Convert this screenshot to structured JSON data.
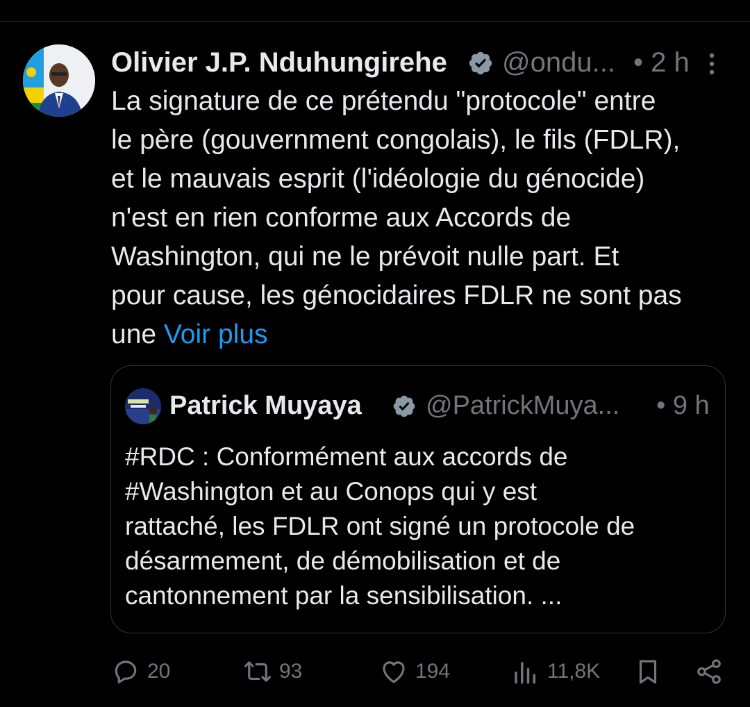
{
  "tweet": {
    "author_name": "Olivier J.P. Nduhungirehe",
    "handle": "@ondu...",
    "time": "• 2 h",
    "text_lines": [
      "La signature de ce prétendu \"protocole\" entre",
      "le père (gouvernment congolais), le fils (FDLR),",
      "et le mauvais esprit (l'idéologie du génocide)",
      "n'est en rien conforme aux Accords de",
      "Washington, qui ne le prévoit nulle part. Et",
      "pour cause, les génocidaires FDLR ne sont pas",
      "une"
    ],
    "see_more": "Voir plus",
    "avatar_icon": "profile-photo",
    "verified_icon": "verified-badge-icon",
    "more_icon": "more-vertical-icon"
  },
  "quote": {
    "author_name": "Patrick Muyaya",
    "handle": "@PatrickMuya...",
    "time": "• 9 h",
    "text_lines": [
      "#RDC : Conformément aux accords de",
      "#Washington et au Conops qui y est",
      "rattaché, les FDLR ont signé un protocole de",
      "désarmement, de démobilisation et de",
      "cantonnement par la sensibilisation. ..."
    ]
  },
  "actions": {
    "replies": "20",
    "reposts": "93",
    "likes": "194",
    "views": "11,8K",
    "reply_icon": "reply-icon",
    "repost_icon": "repost-icon",
    "like_icon": "heart-icon",
    "views_icon": "views-chart-icon",
    "bookmark_icon": "bookmark-icon",
    "share_icon": "share-icon"
  },
  "colors": {
    "background": "#000000",
    "text": "#e7e9ea",
    "muted": "#71767b",
    "link": "#1d9bf0",
    "border": "#2f3336"
  }
}
